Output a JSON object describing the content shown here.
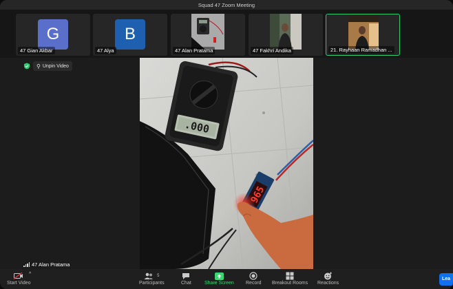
{
  "window": {
    "title": "Squad 47 Zoom Meeting"
  },
  "gallery": [
    {
      "name": "47 Gian Akbar",
      "initial": "G",
      "color": "#5a6fc9"
    },
    {
      "name": "47 Alya",
      "initial": "B",
      "color": "#1f5fb0"
    },
    {
      "name": "47 Alan Pratama"
    },
    {
      "name": "47 Fakhri Andika"
    },
    {
      "name": "21. Rayhaan Ramadhan ..."
    }
  ],
  "stage": {
    "unpin_label": "Unpin Video",
    "speaker_name": "47 Alan Pratama",
    "multimeter_reading": ".000",
    "voltmeter_reading": "965"
  },
  "toolbar": {
    "start_video": "Start Video",
    "participants": "Participants",
    "participants_count": "5",
    "chat": "Chat",
    "share_screen": "Share Screen",
    "record": "Record",
    "breakout_rooms": "Breakout Rooms",
    "reactions": "Reactions",
    "learn": "Lea"
  },
  "colors": {
    "accent_green": "#2ecc71",
    "share_green": "#3ad671",
    "blue": "#0e72ed"
  }
}
